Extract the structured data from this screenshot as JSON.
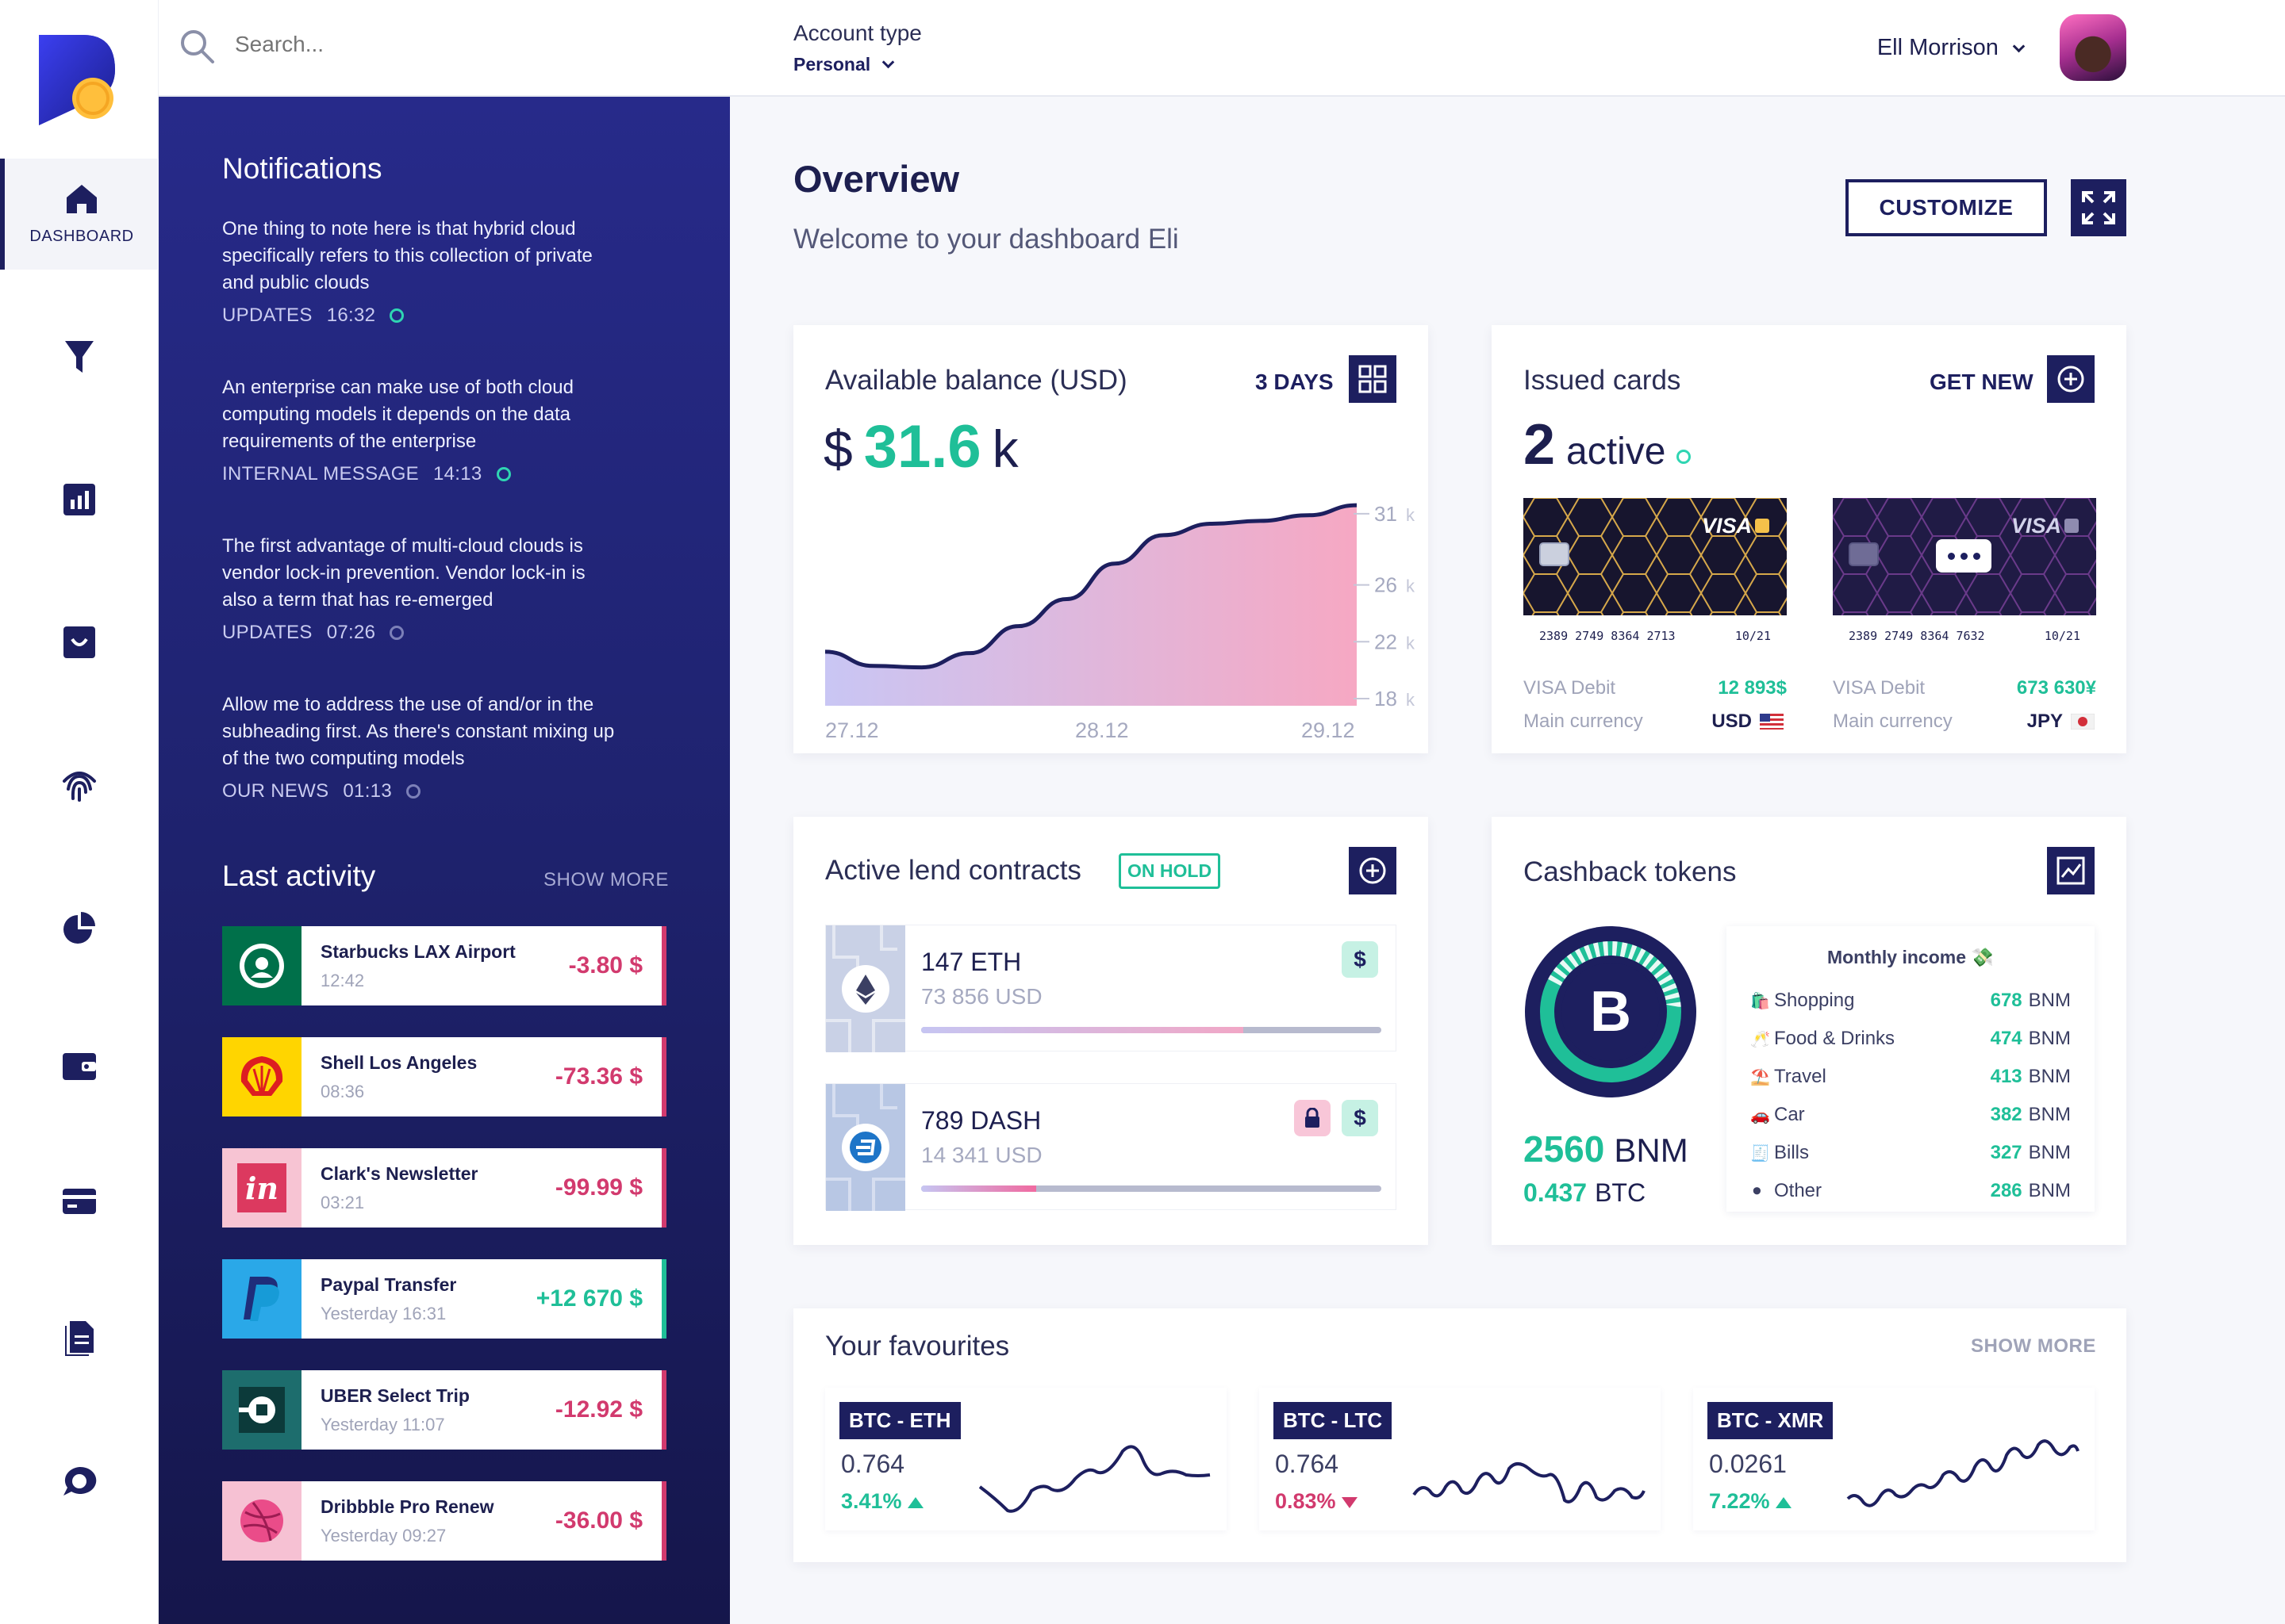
{
  "app": {
    "nav_label_dashboard": "DASHBOARD"
  },
  "colors": {
    "accent": "#1fbf98",
    "navy": "#1d1f5f",
    "negative": "#d23a6e",
    "panel": "#1f2370"
  },
  "search": {
    "placeholder": "Search..."
  },
  "account": {
    "label": "Account type",
    "value": "Personal"
  },
  "user": {
    "name": "Ell Morrison"
  },
  "notifications": {
    "title": "Notifications",
    "items": [
      {
        "text": "One thing to note here is that hybrid cloud specifically refers to this collection of private and public clouds",
        "category": "UPDATES",
        "time": "16:32",
        "unread": true
      },
      {
        "text": "An enterprise can make use of both cloud computing models it depends on the data requirements of the enterprise",
        "category": "INTERNAL MESSAGE",
        "time": "14:13",
        "unread": true
      },
      {
        "text": "The first advantage of multi-cloud clouds is vendor lock-in prevention. Vendor lock-in is also a term that has re-emerged",
        "category": "UPDATES",
        "time": "07:26",
        "unread": false
      },
      {
        "text": "Allow me to address the use of and/or in the subheading first. As there's constant mixing up of the two computing models",
        "category": "OUR NEWS",
        "time": "01:13",
        "unread": false
      }
    ]
  },
  "activity": {
    "title": "Last activity",
    "show_more": "SHOW MORE",
    "items": [
      {
        "merchant": "Starbucks LAX Airport",
        "time": "12:42",
        "amount": "-3.80",
        "currency": "$",
        "icon": "starbucks-logo-icon"
      },
      {
        "merchant": "Shell Los Angeles",
        "time": "08:36",
        "amount": "-73.36",
        "currency": "$",
        "icon": "shell-logo-icon"
      },
      {
        "merchant": "Clark's Newsletter",
        "time": "03:21",
        "amount": "-99.99",
        "currency": "$",
        "icon": "invision-logo-icon"
      },
      {
        "merchant": "Paypal Transfer",
        "time": "Yesterday 16:31",
        "amount": "+12 670",
        "currency": "$",
        "icon": "paypal-logo-icon"
      },
      {
        "merchant": "UBER Select Trip",
        "time": "Yesterday 11:07",
        "amount": "-12.92",
        "currency": "$",
        "icon": "uber-logo-icon"
      },
      {
        "merchant": "Dribbble Pro Renew",
        "time": "Yesterday 09:27",
        "amount": "-36.00",
        "currency": "$",
        "icon": "dribbble-logo-icon"
      }
    ]
  },
  "overview": {
    "title": "Overview",
    "subtitle": "Welcome to your dashboard Eli",
    "customize": "CUSTOMIZE"
  },
  "balance": {
    "title": "Available balance (USD)",
    "period": "3 DAYS",
    "currency_symbol": "$",
    "amount": "31.6",
    "unit": "k",
    "chart_data": {
      "type": "area",
      "x": [
        "27.12",
        "28.12",
        "29.12"
      ],
      "x_ticks": [
        "27.12",
        "28.12",
        "29.12"
      ],
      "series": [
        {
          "values": [
            21.3,
            20.3,
            20.2,
            21.2,
            23.1,
            25.0,
            27.5,
            29.5,
            30.3,
            30.5,
            30.9,
            31.6
          ]
        }
      ],
      "y_ticks": [
        "31",
        "26",
        "22",
        "18"
      ],
      "y_unit": "k",
      "ylim": [
        17.5,
        32
      ]
    }
  },
  "cards": {
    "title": "Issued cards",
    "get_new": "GET NEW",
    "active_count": "2",
    "active_label": "active",
    "items": [
      {
        "brand": "VISA",
        "number": "2389 2749 8364 2713",
        "expiry": "10/21",
        "type": "VISA Debit",
        "balance": "12 893$",
        "currency_label": "Main currency",
        "currency": "USD",
        "flag": "us-flag-icon"
      },
      {
        "brand": "VISA",
        "number": "2389 2749 8364 7632",
        "expiry": "10/21",
        "type": "VISA Debit",
        "balance": "673 630¥",
        "currency_label": "Main currency",
        "currency": "JPY",
        "flag": "jp-flag-icon"
      }
    ]
  },
  "lend": {
    "title": "Active lend contracts",
    "status": "ON HOLD",
    "items": [
      {
        "amount": "147",
        "coin": "ETH",
        "usd": "73 856 USD",
        "progress": 0.7,
        "locked": false
      },
      {
        "amount": "789",
        "coin": "DASH",
        "usd": "14 341 USD",
        "progress": 0.25,
        "locked": true
      }
    ]
  },
  "cashback": {
    "title": "Cashback tokens",
    "token_amount": "2560",
    "token_unit": "BNM",
    "btc_amount": "0.437",
    "btc_unit": "BTC",
    "income_title": "Monthly income",
    "income": [
      {
        "label": "Shopping",
        "value": "678",
        "unit": "BNM",
        "icon": "shopping-bag-icon"
      },
      {
        "label": "Food & Drinks",
        "value": "474",
        "unit": "BNM",
        "icon": "cheers-icon"
      },
      {
        "label": "Travel",
        "value": "413",
        "unit": "BNM",
        "icon": "beach-icon"
      },
      {
        "label": "Car",
        "value": "382",
        "unit": "BNM",
        "icon": "car-icon"
      },
      {
        "label": "Bills",
        "value": "327",
        "unit": "BNM",
        "icon": "receipt-icon"
      },
      {
        "label": "Other",
        "value": "286",
        "unit": "BNM",
        "icon": "other-icon"
      }
    ]
  },
  "favourites": {
    "title": "Your favourites",
    "show_more": "SHOW MORE",
    "items": [
      {
        "pair": "BTC - ETH",
        "value": "0.764",
        "change": "3.41%",
        "direction": "up"
      },
      {
        "pair": "BTC - LTC",
        "value": "0.764",
        "change": "0.83%",
        "direction": "down"
      },
      {
        "pair": "BTC - XMR",
        "value": "0.0261",
        "change": "7.22%",
        "direction": "up"
      }
    ]
  }
}
